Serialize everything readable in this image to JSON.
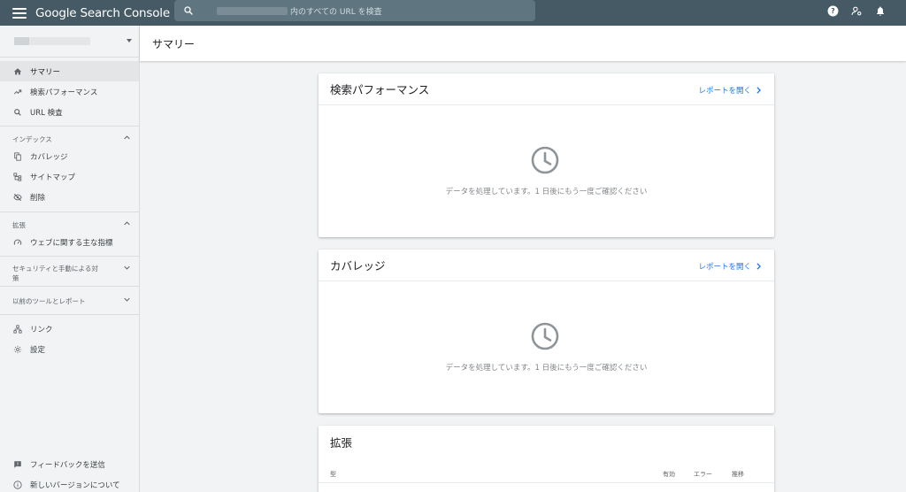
{
  "app": {
    "title": "Google Search Console",
    "search_placeholder": "内のすべての URL を検査"
  },
  "sidebar": {
    "items": [
      {
        "label": "サマリー",
        "icon": "home-icon",
        "active": true
      },
      {
        "label": "検索パフォーマンス",
        "icon": "trending-up-icon"
      },
      {
        "label": "URL 検査",
        "icon": "search-icon"
      }
    ],
    "index_section": {
      "label": "インデックス",
      "items": [
        {
          "label": "カバレッジ",
          "icon": "copy-icon"
        },
        {
          "label": "サイトマップ",
          "icon": "sitemap-icon"
        },
        {
          "label": "削除",
          "icon": "visibility-off-icon"
        }
      ]
    },
    "enhancements_section": {
      "label": "拡張",
      "items": [
        {
          "label": "ウェブに関する主な指標",
          "icon": "speed-icon"
        }
      ]
    },
    "security_section": {
      "label_line1": "セキュリティと手動による対",
      "label_line2": "策"
    },
    "legacy_section": {
      "label": "以前のツールとレポート"
    },
    "bottom_items": [
      {
        "label": "リンク",
        "icon": "links-icon"
      },
      {
        "label": "設定",
        "icon": "gear-icon"
      }
    ],
    "footer_items": [
      {
        "label": "フィードバックを送信",
        "icon": "feedback-icon"
      },
      {
        "label": "新しいバージョンについて",
        "icon": "info-icon"
      }
    ]
  },
  "main": {
    "title": "サマリー",
    "cards": [
      {
        "title": "検索パフォーマンス",
        "link": "レポートを開く",
        "message": "データを処理しています。1 日後にもう一度ご確認ください"
      },
      {
        "title": "カバレッジ",
        "link": "レポートを開く",
        "message": "データを処理しています。1 日後にもう一度ご確認ください"
      },
      {
        "title": "拡張",
        "columns": [
          "型",
          "有効",
          "エラー",
          "推移"
        ]
      }
    ]
  }
}
